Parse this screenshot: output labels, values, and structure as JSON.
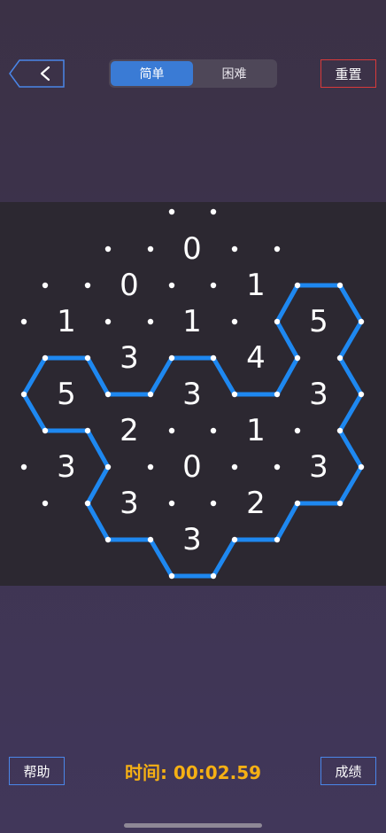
{
  "header": {
    "back_icon": "chevron-left-icon",
    "tabs": [
      {
        "label": "简单",
        "active": true
      },
      {
        "label": "困难",
        "active": false
      }
    ],
    "reset_label": "重置"
  },
  "board": {
    "line_color": "#1e88f0",
    "dot_color": "#ffffff",
    "text_color": "#ffffff",
    "cells": [
      {
        "row": 0,
        "col": 3,
        "value": "0"
      },
      {
        "row": 1,
        "col": 2,
        "value": "0"
      },
      {
        "row": 1,
        "col": 4,
        "value": "1"
      },
      {
        "row": 2,
        "col": 1,
        "value": "1"
      },
      {
        "row": 2,
        "col": 3,
        "value": "1"
      },
      {
        "row": 2,
        "col": 5,
        "value": "5"
      },
      {
        "row": 3,
        "col": 2,
        "value": "3"
      },
      {
        "row": 3,
        "col": 4,
        "value": "4"
      },
      {
        "row": 4,
        "col": 1,
        "value": "5"
      },
      {
        "row": 4,
        "col": 3,
        "value": "3"
      },
      {
        "row": 4,
        "col": 5,
        "value": "3"
      },
      {
        "row": 5,
        "col": 2,
        "value": "2"
      },
      {
        "row": 5,
        "col": 4,
        "value": "1"
      },
      {
        "row": 6,
        "col": 1,
        "value": "3"
      },
      {
        "row": 6,
        "col": 3,
        "value": "0"
      },
      {
        "row": 6,
        "col": 5,
        "value": "3"
      },
      {
        "row": 7,
        "col": 2,
        "value": "3"
      },
      {
        "row": 7,
        "col": 4,
        "value": "2"
      },
      {
        "row": 8,
        "col": 3,
        "value": "3"
      }
    ]
  },
  "footer": {
    "help_label": "帮助",
    "timer_text": "时间: 00:02.59",
    "score_label": "成绩"
  }
}
